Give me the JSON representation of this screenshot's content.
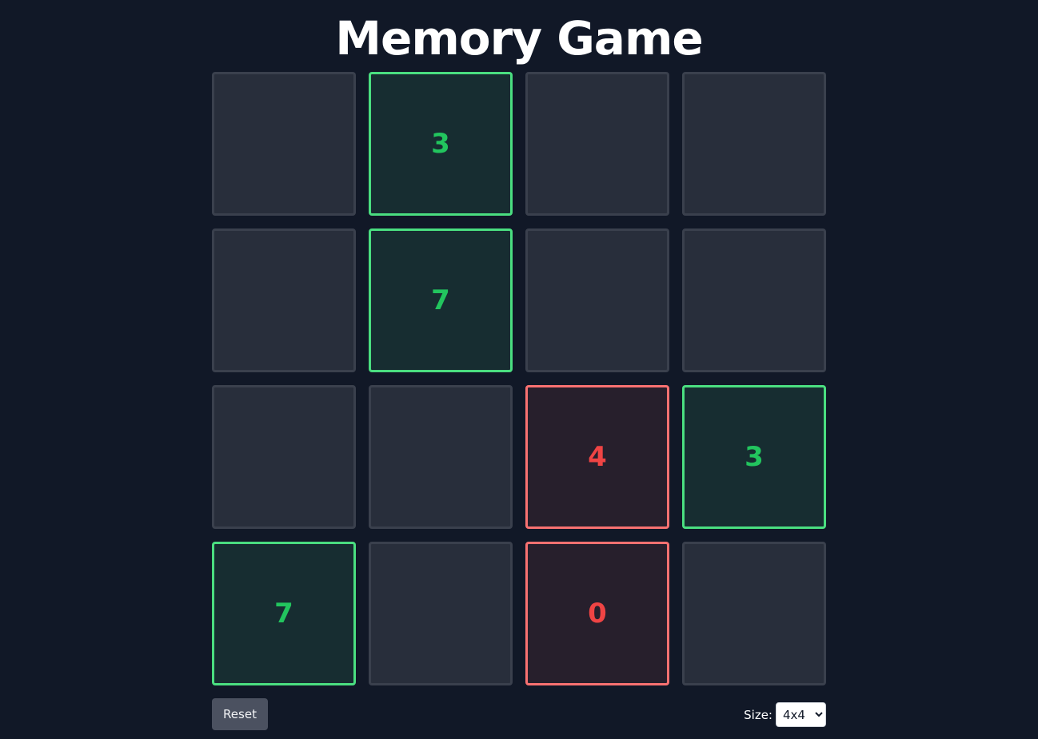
{
  "title": "Memory Game",
  "colors": {
    "background": "#111827",
    "tile_hidden": "#282e3b",
    "matched_border": "#4ade80",
    "matched_text": "#22c55e",
    "wrong_border": "#f87171",
    "wrong_text": "#ef4444"
  },
  "board": {
    "rows": 4,
    "cols": 4,
    "tiles": [
      {
        "value": "",
        "state": "hidden"
      },
      {
        "value": "3",
        "state": "matched"
      },
      {
        "value": "",
        "state": "hidden"
      },
      {
        "value": "",
        "state": "hidden"
      },
      {
        "value": "",
        "state": "hidden"
      },
      {
        "value": "7",
        "state": "matched"
      },
      {
        "value": "",
        "state": "hidden"
      },
      {
        "value": "",
        "state": "hidden"
      },
      {
        "value": "",
        "state": "hidden"
      },
      {
        "value": "",
        "state": "hidden"
      },
      {
        "value": "4",
        "state": "wrong"
      },
      {
        "value": "3",
        "state": "matched"
      },
      {
        "value": "7",
        "state": "matched"
      },
      {
        "value": "",
        "state": "hidden"
      },
      {
        "value": "0",
        "state": "wrong"
      },
      {
        "value": "",
        "state": "hidden"
      }
    ]
  },
  "controls": {
    "reset_label": "Reset",
    "size_label": "Size:",
    "size_selected": "4x4"
  }
}
